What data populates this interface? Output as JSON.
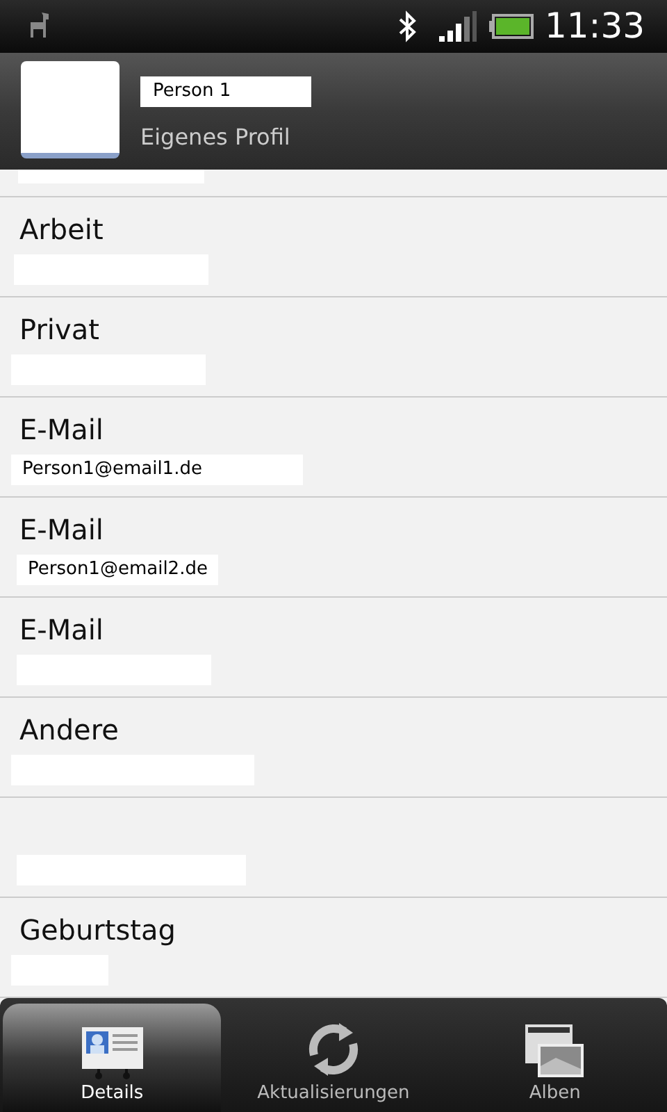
{
  "status_bar": {
    "time": "11:33"
  },
  "header": {
    "name": "Person 1",
    "subtitle": "Eigenes Profil"
  },
  "fields": [
    {
      "kind": "labeled",
      "label": "Arbeit"
    },
    {
      "kind": "labeled",
      "label": "Privat"
    },
    {
      "kind": "labeled",
      "label": "E-Mail",
      "value": "Person1@email1.de"
    },
    {
      "kind": "labeled",
      "label": "E-Mail",
      "value": "Person1@email2.de"
    },
    {
      "kind": "labeled",
      "label": "E-Mail"
    },
    {
      "kind": "labeled",
      "label": "Andere"
    },
    {
      "kind": "unlabeled"
    },
    {
      "kind": "labeled",
      "label": "Geburtstag"
    }
  ],
  "tabs": [
    {
      "label": "Details",
      "kind": "details",
      "selected": true
    },
    {
      "label": "Aktualisierungen",
      "kind": "updates",
      "selected": false
    },
    {
      "label": "Alben",
      "kind": "albums",
      "selected": false
    }
  ]
}
